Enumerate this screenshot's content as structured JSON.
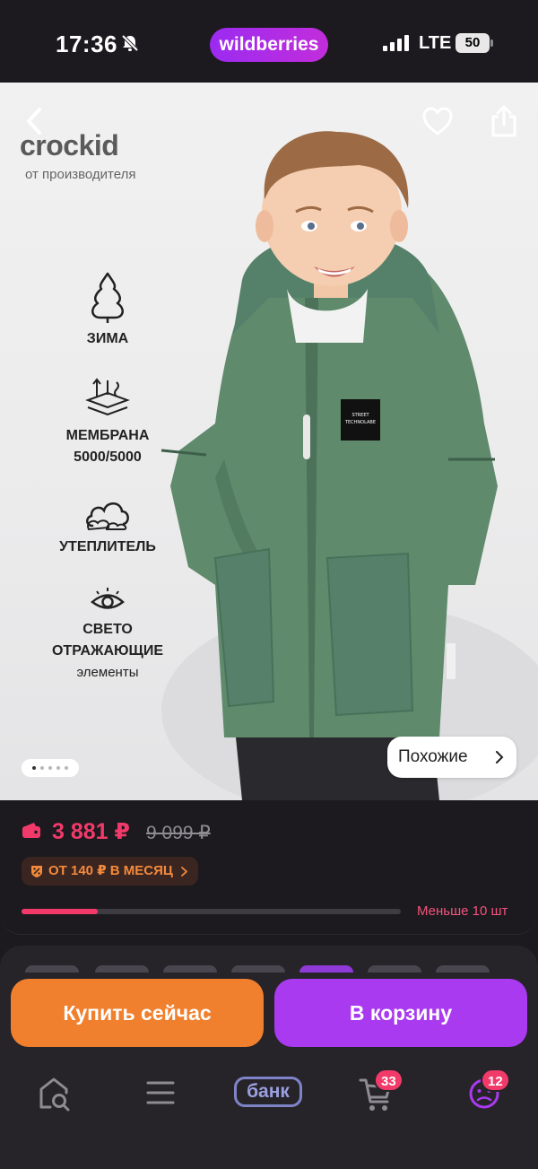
{
  "status_bar": {
    "time": "17:36",
    "app_pill": "wildberries",
    "network": "LTE",
    "battery": "50"
  },
  "product": {
    "brand": "crockid",
    "brand_subtitle": "от производителя",
    "features": [
      {
        "icon": "tree-icon",
        "title": "ЗИМА",
        "subtitle": ""
      },
      {
        "icon": "membrane-icon",
        "title": "МЕМБРАНА",
        "subtitle": "5000/5000"
      },
      {
        "icon": "cloud-icon",
        "title": "УТЕПЛИТЕЛЬ",
        "subtitle": ""
      },
      {
        "icon": "eye-icon",
        "title": "СВЕТО\nОТРАЖАЮЩИЕ",
        "subtitle": "элементы"
      }
    ],
    "jacket_patch": "STREET TECHNOLABE",
    "gallery_index": 1,
    "gallery_total": 5,
    "similar_label": "Похожие"
  },
  "pricing": {
    "price": "3 881 ₽",
    "old_price": "9 099 ₽",
    "installment": "ОТ 140 ₽ В МЕСЯЦ",
    "stock_label": "Меньше 10 шт",
    "stock_level": 0.2
  },
  "actions": {
    "buy_now": "Купить сейчас",
    "add_to_cart": "В корзину"
  },
  "nav": {
    "bank_label": "банк",
    "cart_badge": "33",
    "profile_badge": "12"
  },
  "colors": {
    "accent_pink": "#f23a6a",
    "buy_orange": "#f0802e",
    "cart_purple": "#a93af0",
    "jacket_green": "#5f8a6c"
  }
}
